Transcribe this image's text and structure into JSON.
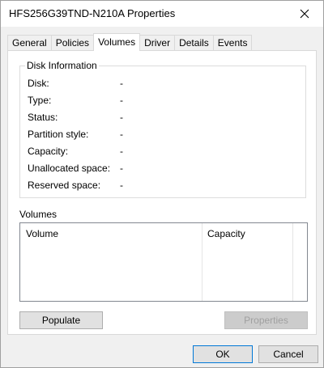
{
  "window": {
    "title": "HFS256G39TND-N210A Properties"
  },
  "tabs": [
    {
      "label": "General"
    },
    {
      "label": "Policies"
    },
    {
      "label": "Volumes"
    },
    {
      "label": "Driver"
    },
    {
      "label": "Details"
    },
    {
      "label": "Events"
    }
  ],
  "active_tab": "Volumes",
  "disk_info": {
    "legend": "Disk Information",
    "rows": [
      {
        "label": "Disk:",
        "value": "-"
      },
      {
        "label": "Type:",
        "value": "-"
      },
      {
        "label": "Status:",
        "value": "-"
      },
      {
        "label": "Partition style:",
        "value": "-"
      },
      {
        "label": "Capacity:",
        "value": "-"
      },
      {
        "label": "Unallocated space:",
        "value": "-"
      },
      {
        "label": "Reserved space:",
        "value": "-"
      }
    ]
  },
  "volumes": {
    "label": "Volumes",
    "columns": [
      {
        "label": "Volume"
      },
      {
        "label": "Capacity"
      }
    ]
  },
  "buttons": {
    "populate": "Populate",
    "properties": "Properties",
    "ok": "OK",
    "cancel": "Cancel"
  },
  "icons": {
    "close": "close-icon"
  },
  "colors": {
    "focus_border": "#0078d7",
    "dialog_bg": "#f0f0f0"
  }
}
